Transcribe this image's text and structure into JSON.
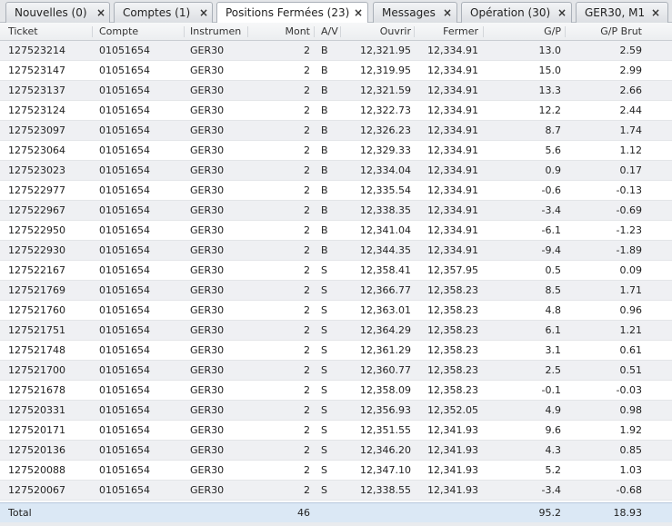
{
  "tabs": [
    {
      "label": "Nouvelles (0)",
      "close": "×"
    },
    {
      "label": "Comptes (1)",
      "close": "×"
    },
    {
      "label": "Positions Fermées (23)",
      "close": "×"
    },
    {
      "label": "Messages",
      "close": "×"
    },
    {
      "label": "Opération (30)",
      "close": "×"
    },
    {
      "label": "GER30, M1",
      "close": "×"
    }
  ],
  "active_tab": "Positions Fermées (23)",
  "columns": [
    "Ticket",
    "Compte",
    "Instrumen",
    "Mont",
    "A/V",
    "Ouvrir",
    "Fermer",
    "G/P",
    "G/P Brut"
  ],
  "rows": [
    [
      "127523214",
      "01051654",
      "GER30",
      "2",
      "B",
      "12,321.95",
      "12,334.91",
      "13.0",
      "2.59"
    ],
    [
      "127523147",
      "01051654",
      "GER30",
      "2",
      "B",
      "12,319.95",
      "12,334.91",
      "15.0",
      "2.99"
    ],
    [
      "127523137",
      "01051654",
      "GER30",
      "2",
      "B",
      "12,321.59",
      "12,334.91",
      "13.3",
      "2.66"
    ],
    [
      "127523124",
      "01051654",
      "GER30",
      "2",
      "B",
      "12,322.73",
      "12,334.91",
      "12.2",
      "2.44"
    ],
    [
      "127523097",
      "01051654",
      "GER30",
      "2",
      "B",
      "12,326.23",
      "12,334.91",
      "8.7",
      "1.74"
    ],
    [
      "127523064",
      "01051654",
      "GER30",
      "2",
      "B",
      "12,329.33",
      "12,334.91",
      "5.6",
      "1.12"
    ],
    [
      "127523023",
      "01051654",
      "GER30",
      "2",
      "B",
      "12,334.04",
      "12,334.91",
      "0.9",
      "0.17"
    ],
    [
      "127522977",
      "01051654",
      "GER30",
      "2",
      "B",
      "12,335.54",
      "12,334.91",
      "-0.6",
      "-0.13"
    ],
    [
      "127522967",
      "01051654",
      "GER30",
      "2",
      "B",
      "12,338.35",
      "12,334.91",
      "-3.4",
      "-0.69"
    ],
    [
      "127522950",
      "01051654",
      "GER30",
      "2",
      "B",
      "12,341.04",
      "12,334.91",
      "-6.1",
      "-1.23"
    ],
    [
      "127522930",
      "01051654",
      "GER30",
      "2",
      "B",
      "12,344.35",
      "12,334.91",
      "-9.4",
      "-1.89"
    ],
    [
      "127522167",
      "01051654",
      "GER30",
      "2",
      "S",
      "12,358.41",
      "12,357.95",
      "0.5",
      "0.09"
    ],
    [
      "127521769",
      "01051654",
      "GER30",
      "2",
      "S",
      "12,366.77",
      "12,358.23",
      "8.5",
      "1.71"
    ],
    [
      "127521760",
      "01051654",
      "GER30",
      "2",
      "S",
      "12,363.01",
      "12,358.23",
      "4.8",
      "0.96"
    ],
    [
      "127521751",
      "01051654",
      "GER30",
      "2",
      "S",
      "12,364.29",
      "12,358.23",
      "6.1",
      "1.21"
    ],
    [
      "127521748",
      "01051654",
      "GER30",
      "2",
      "S",
      "12,361.29",
      "12,358.23",
      "3.1",
      "0.61"
    ],
    [
      "127521700",
      "01051654",
      "GER30",
      "2",
      "S",
      "12,360.77",
      "12,358.23",
      "2.5",
      "0.51"
    ],
    [
      "127521678",
      "01051654",
      "GER30",
      "2",
      "S",
      "12,358.09",
      "12,358.23",
      "-0.1",
      "-0.03"
    ],
    [
      "127520331",
      "01051654",
      "GER30",
      "2",
      "S",
      "12,356.93",
      "12,352.05",
      "4.9",
      "0.98"
    ],
    [
      "127520171",
      "01051654",
      "GER30",
      "2",
      "S",
      "12,351.55",
      "12,341.93",
      "9.6",
      "1.92"
    ],
    [
      "127520136",
      "01051654",
      "GER30",
      "2",
      "S",
      "12,346.20",
      "12,341.93",
      "4.3",
      "0.85"
    ],
    [
      "127520088",
      "01051654",
      "GER30",
      "2",
      "S",
      "12,347.10",
      "12,341.93",
      "5.2",
      "1.03"
    ],
    [
      "127520067",
      "01051654",
      "GER30",
      "2",
      "S",
      "12,338.55",
      "12,341.93",
      "-3.4",
      "-0.68"
    ]
  ],
  "total": {
    "label": "Total",
    "mont": "46",
    "gp": "95.2",
    "gp_brut": "18.93"
  }
}
